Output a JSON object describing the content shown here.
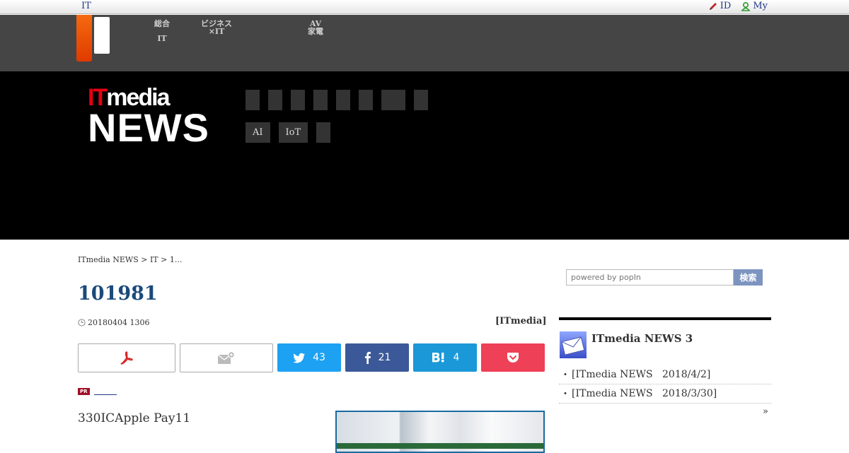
{
  "topbar": {
    "site_link": "IT",
    "id_label": "ID",
    "my_label": "My"
  },
  "darknav": {
    "items": [
      {
        "line1": "総合",
        "line2": "IT"
      },
      {
        "line1": "ビジネス",
        "line2": "×IT"
      },
      {
        "line1": "AV",
        "line2": "家電"
      }
    ]
  },
  "header": {
    "logo_it": "IT",
    "logo_media": "media",
    "logo_news": "NEWS",
    "tags": [
      "AI",
      "IoT"
    ]
  },
  "breadcrumb": "ITmedia NEWS > IT > 1...",
  "search": {
    "placeholder": "powered by popIn",
    "button": "検索"
  },
  "article": {
    "title": "101981",
    "date": "20180404 1306",
    "byline": "[ITmedia]",
    "lead": "330ICApple Pay11"
  },
  "share": {
    "twitter_count": "43",
    "facebook_count": "21",
    "hatena_count": "4"
  },
  "pr": {
    "badge": "PR"
  },
  "sidebar": {
    "title": "ITmedia NEWS 3",
    "items": [
      {
        "name": "[ITmedia NEWS",
        "date": "2018/4/2]"
      },
      {
        "name": "[ITmedia NEWS",
        "date": "2018/3/30]"
      }
    ],
    "more": "»"
  },
  "colors": {
    "twitter": "#1da1f2",
    "facebook": "#3b5998",
    "hatena": "#1b98d8",
    "pocket": "#ee4056",
    "logo_red": "#e60012",
    "title_blue": "#1a4a7a"
  }
}
